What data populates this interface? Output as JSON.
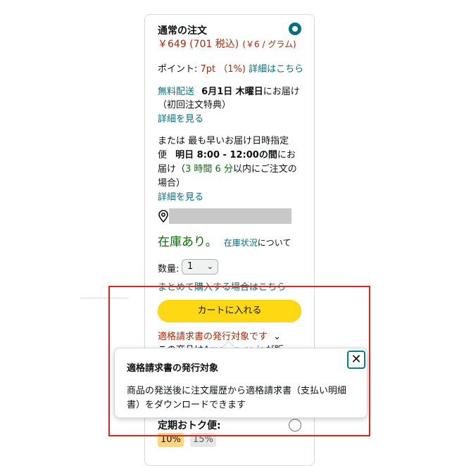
{
  "option": {
    "title": "通常の注文",
    "price": "￥649 (701 税込)",
    "unit_price": "(￥6 / グラム)"
  },
  "points": {
    "label": "ポイント: ",
    "value": "7pt （1%)",
    "link": "詳細はこちら"
  },
  "delivery": {
    "free": "無料配送",
    "date": "6月1日 木曜日",
    "suffix": "にお届け",
    "note": "（初回注文特典）",
    "details_link": "詳細を見る"
  },
  "fastest": {
    "line1_prefix": "または",
    "line1_rest": "最も早いお届け日時指定",
    "line2_prefix": "便",
    "line2_bold": "明日 8:00 - 12:00の間",
    "line2_suffix": "にお",
    "line3_prefix": "届け（",
    "line3_time": "3 時間 6 分",
    "line3_suffix": "以内にご注文の",
    "line4": "場合）",
    "details_link": "詳細を見る"
  },
  "stock": {
    "status": "在庫あり。",
    "link": "在庫状況",
    "suffix": "について"
  },
  "quantity": {
    "label": "数量:",
    "value": "1",
    "bulk_link": "まとめて購入する場合はこちら"
  },
  "cart_button": "カートに入れる",
  "invoice_link": "適格請求書の発行対象です",
  "hidden_line_prefix": "この商品は",
  "hidden_line_link": "Amazon.co.jp",
  "hidden_line_suffix": "が販",
  "popover": {
    "title": "適格請求書の発行対象",
    "line1": "商品の発送後に注文履歴から適格請求書（支払い明細",
    "line2": "書）をダウンロードできます"
  },
  "subscription": {
    "title": "定期おトク便:",
    "tags": [
      "10%",
      "15%"
    ]
  }
}
